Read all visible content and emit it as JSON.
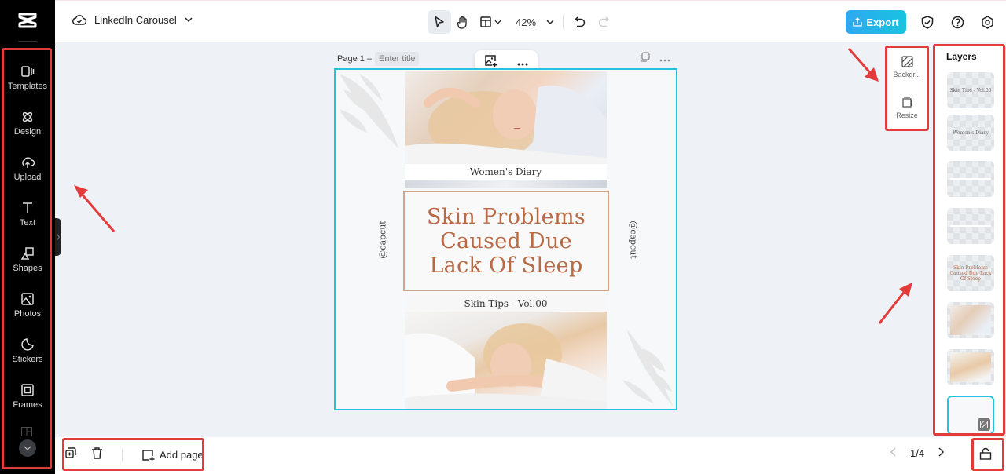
{
  "app": {
    "project_title": "LinkedIn Carousel",
    "zoom_level": "42%",
    "export_label": "Export"
  },
  "sidebar": {
    "items": [
      {
        "label": "Templates",
        "icon": "templates-icon"
      },
      {
        "label": "Design",
        "icon": "design-icon"
      },
      {
        "label": "Upload",
        "icon": "upload-icon"
      },
      {
        "label": "Text",
        "icon": "text-icon"
      },
      {
        "label": "Shapes",
        "icon": "shapes-icon"
      },
      {
        "label": "Photos",
        "icon": "photos-icon"
      },
      {
        "label": "Stickers",
        "icon": "stickers-icon"
      },
      {
        "label": "Frames",
        "icon": "frames-icon"
      }
    ]
  },
  "canvas": {
    "page_label": "Page 1 –",
    "title_placeholder": "Enter title",
    "design": {
      "top_caption": "Women's Diary",
      "headline": [
        "Skin Problems",
        "Caused Due",
        "Lack Of Sleep"
      ],
      "bottom_caption": "Skin Tips - Vol.00",
      "handle": "@capcut"
    }
  },
  "mini_panel": {
    "background_label": "Backgr...",
    "resize_label": "Resize"
  },
  "layers": {
    "title": "Layers",
    "items": [
      {
        "type": "text",
        "label": "Skin Tips - Vol.00"
      },
      {
        "type": "text",
        "label": "Women's Diary"
      },
      {
        "type": "shape",
        "label": ""
      },
      {
        "type": "shape",
        "label": ""
      },
      {
        "type": "text",
        "label": "Skin Problems Caused Due Lack Of Sleep"
      },
      {
        "type": "image",
        "label": ""
      },
      {
        "type": "image",
        "label": ""
      },
      {
        "type": "background",
        "label": ""
      }
    ]
  },
  "bottom": {
    "add_page_label": "Add page",
    "page_indicator": "1/4"
  },
  "colors": {
    "accent": "#22c3dc",
    "export_gradient_start": "#2fa8f0",
    "headline": "#b76a45",
    "annotation": "#e33b3b"
  }
}
